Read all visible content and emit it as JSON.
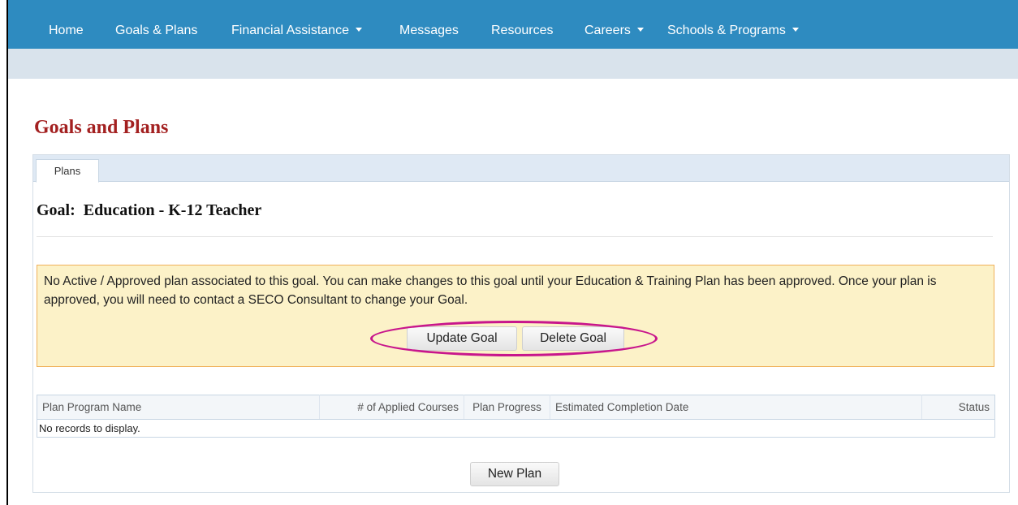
{
  "nav": {
    "home": "Home",
    "goals_plans": "Goals & Plans",
    "financial_assistance": "Financial Assistance",
    "messages": "Messages",
    "resources": "Resources",
    "careers": "Careers",
    "schools_programs": "Schools & Programs"
  },
  "page": {
    "title": "Goals and Plans",
    "tab": "Plans",
    "goal_heading": "Goal:  Education - K-12 Teacher"
  },
  "alert": {
    "message": "No Active / Approved plan associated to this goal. You can make changes to this goal until your Education & Training Plan has been approved. Once your plan is approved, you will need to contact a SECO Consultant to change your Goal.",
    "update_label": "Update Goal",
    "delete_label": "Delete Goal"
  },
  "table": {
    "columns": [
      "Plan Program Name",
      "# of Applied Courses",
      "Plan Progress",
      "Estimated Completion Date",
      "Status"
    ],
    "empty_text": "No records to display."
  },
  "actions": {
    "new_plan_label": "New Plan"
  },
  "colors": {
    "nav_bg": "#2e8bc0",
    "title": "#a32020",
    "alert_bg": "#fcf2c8",
    "alert_border": "#f0b15a",
    "highlight": "#c8168c"
  }
}
